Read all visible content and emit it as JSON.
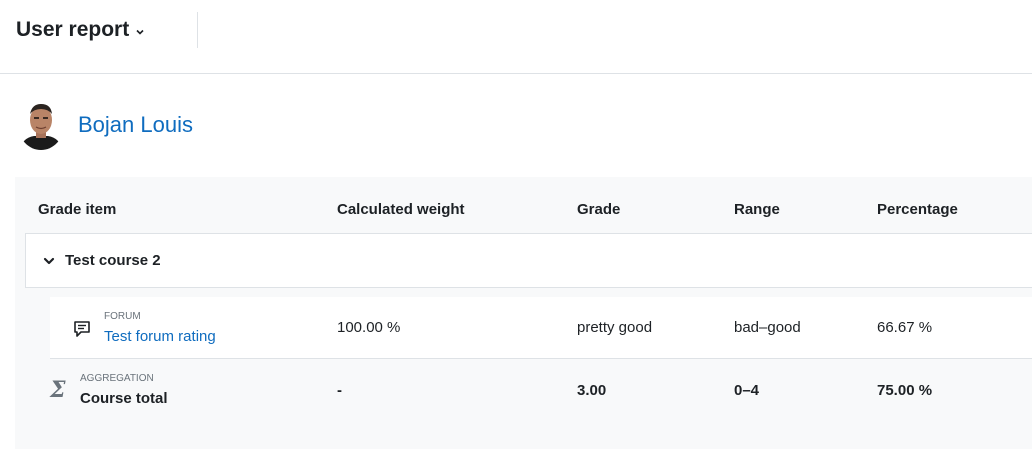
{
  "header": {
    "title": "User report"
  },
  "user": {
    "name": "Bojan Louis"
  },
  "table": {
    "columns": [
      "Grade item",
      "Calculated weight",
      "Grade",
      "Range",
      "Percentage"
    ],
    "category": {
      "name": "Test course 2"
    },
    "item": {
      "type": "FORUM",
      "name": "Test forum rating",
      "weight": "100.00 %",
      "grade": "pretty good",
      "range": "bad–good",
      "percentage": "66.67 %"
    },
    "total": {
      "type": "AGGREGATION",
      "name": "Course total",
      "weight": "-",
      "grade": "3.00",
      "range": "0–4",
      "percentage": "75.00 %"
    }
  }
}
